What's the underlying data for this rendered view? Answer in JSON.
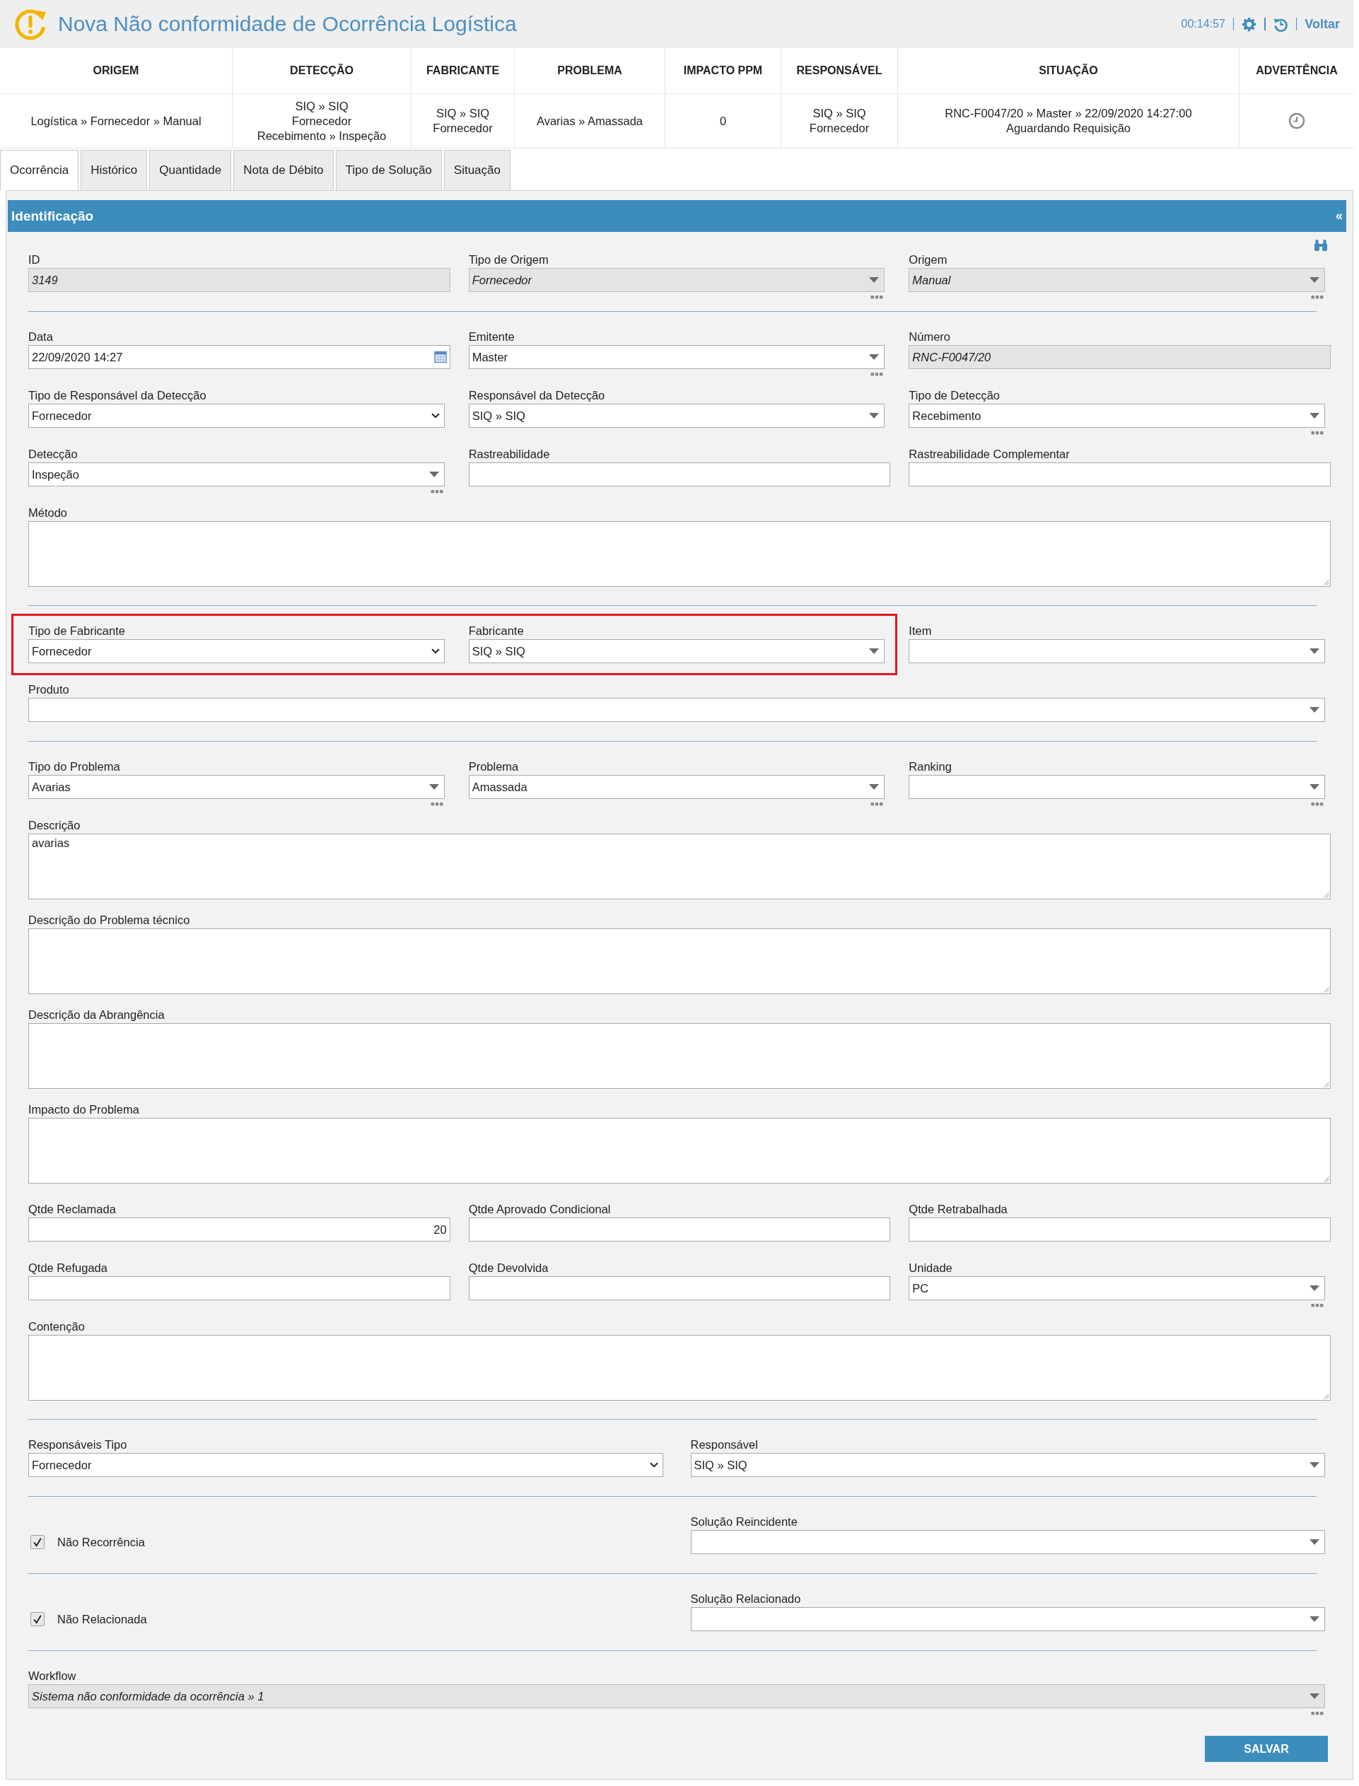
{
  "header": {
    "title": "Nova Não conformidade de Ocorrência Logística",
    "timer": "00:14:57",
    "back_link": "Voltar"
  },
  "summary": {
    "columns": [
      "ORIGEM",
      "DETECÇÃO",
      "FABRICANTE",
      "PROBLEMA",
      "IMPACTO PPM",
      "RESPONSÁVEL",
      "SITUAÇÃO",
      "ADVERTÊNCIA"
    ],
    "cells": [
      {
        "kind": "text",
        "lines": [
          "Logística » Fornecedor » Manual"
        ]
      },
      {
        "kind": "text",
        "lines": [
          "SIQ » SIQ",
          "Fornecedor",
          "Recebimento » Inspeção"
        ]
      },
      {
        "kind": "text",
        "lines": [
          "SIQ » SIQ",
          "Fornecedor"
        ]
      },
      {
        "kind": "text",
        "lines": [
          "Avarias » Amassada"
        ]
      },
      {
        "kind": "text",
        "lines": [
          "0"
        ]
      },
      {
        "kind": "text",
        "lines": [
          "SIQ » SIQ",
          "Fornecedor"
        ]
      },
      {
        "kind": "text",
        "lines": [
          "RNC-F0047/20 » Master » 22/09/2020 14:27:00",
          "Aguardando Requisição"
        ]
      },
      {
        "kind": "clock"
      }
    ]
  },
  "tabs": [
    {
      "label": "Ocorrência",
      "selected": true
    },
    {
      "label": "Histórico",
      "selected": false
    },
    {
      "label": "Quantidade",
      "selected": false
    },
    {
      "label": "Nota de Débito",
      "selected": false
    },
    {
      "label": "Tipo de Solução",
      "selected": false
    },
    {
      "label": "Situação",
      "selected": false
    }
  ],
  "panel": {
    "title": "Identificação",
    "collapse": "«",
    "submit": "SALVAR",
    "rows": [
      {
        "kind": "fields",
        "items": [
          {
            "label": "ID",
            "kind": "text",
            "value": "3149",
            "readonly": true,
            "more": false
          },
          {
            "label": "Tipo de Origem",
            "kind": "combo",
            "value": "Fornecedor",
            "readonly": true,
            "more": true
          },
          {
            "label": "Origem",
            "kind": "combo",
            "value": "Manual",
            "readonly": true,
            "more": true
          }
        ]
      },
      {
        "kind": "divider"
      },
      {
        "kind": "fields",
        "items": [
          {
            "label": "Data",
            "kind": "date",
            "value": "22/09/2020 14:27",
            "readonly": false,
            "more": false
          },
          {
            "label": "Emitente",
            "kind": "combo",
            "value": "Master",
            "readonly": false,
            "more": true
          },
          {
            "label": "Número",
            "kind": "text",
            "value": "RNC-F0047/20",
            "readonly": true,
            "more": false
          }
        ]
      },
      {
        "kind": "fields",
        "items": [
          {
            "label": "Tipo de Responsável da Detecção",
            "kind": "select",
            "value": "Fornecedor",
            "readonly": false,
            "more": false
          },
          {
            "label": "Responsável da Detecção",
            "kind": "combo",
            "value": "SIQ » SIQ",
            "readonly": false,
            "more": false
          },
          {
            "label": "Tipo de Detecção",
            "kind": "combo",
            "value": "Recebimento",
            "readonly": false,
            "more": true
          }
        ]
      },
      {
        "kind": "fields",
        "items": [
          {
            "label": "Detecção",
            "kind": "combo",
            "value": "Inspeção",
            "readonly": false,
            "more": true
          },
          {
            "label": "Rastreabilidade",
            "kind": "text",
            "readonly": false,
            "more": false
          },
          {
            "label": "Rastreabilidade Complementar",
            "kind": "text",
            "readonly": false,
            "more": false
          }
        ]
      },
      {
        "kind": "fields",
        "items": [
          {
            "label": "Método",
            "kind": "textarea",
            "readonly": false
          }
        ]
      },
      {
        "kind": "divider"
      },
      {
        "kind": "fields",
        "items": [
          {
            "kind": "group",
            "highlighted": true,
            "fields": [
              {
                "label": "Tipo de Fabricante",
                "kind": "select",
                "value": "Fornecedor",
                "readonly": false,
                "more": false
              },
              {
                "label": "Fabricante",
                "kind": "combo",
                "value": "SIQ » SIQ",
                "readonly": false,
                "more": false
              }
            ]
          },
          {
            "label": "Item",
            "kind": "combo",
            "readonly": false,
            "more": false
          }
        ]
      },
      {
        "kind": "fields",
        "items": [
          {
            "label": "Produto",
            "kind": "combo",
            "readonly": false,
            "more": false
          }
        ]
      },
      {
        "kind": "divider"
      },
      {
        "kind": "fields",
        "items": [
          {
            "label": "Tipo do Problema",
            "kind": "combo",
            "value": "Avarias",
            "readonly": false,
            "more": true
          },
          {
            "label": "Problema",
            "kind": "combo",
            "value": "Amassada",
            "readonly": false,
            "more": true
          },
          {
            "label": "Ranking",
            "kind": "combo",
            "readonly": false,
            "more": true
          }
        ]
      },
      {
        "kind": "fields",
        "items": [
          {
            "label": "Descrição",
            "kind": "textarea",
            "value": "avarias",
            "readonly": false
          }
        ]
      },
      {
        "kind": "fields",
        "items": [
          {
            "label": "Descrição do Problema técnico",
            "kind": "textarea",
            "readonly": false
          }
        ]
      },
      {
        "kind": "fields",
        "items": [
          {
            "label": "Descrição da Abrangência",
            "kind": "textarea",
            "readonly": false
          }
        ]
      },
      {
        "kind": "fields",
        "items": [
          {
            "label": "Impacto do Problema",
            "kind": "textarea",
            "readonly": false
          }
        ]
      },
      {
        "kind": "fields",
        "items": [
          {
            "label": "Qtde Reclamada",
            "kind": "number",
            "value": "20",
            "readonly": false,
            "more": false
          },
          {
            "label": "Qtde Aprovado Condicional",
            "kind": "text",
            "readonly": false,
            "more": false
          },
          {
            "label": "Qtde Retrabalhada",
            "kind": "text",
            "readonly": false,
            "more": false
          }
        ]
      },
      {
        "kind": "fields",
        "items": [
          {
            "label": "Qtde Refugada",
            "kind": "text",
            "readonly": false,
            "more": false
          },
          {
            "label": "Qtde Devolvida",
            "kind": "text",
            "readonly": false,
            "more": false
          },
          {
            "label": "Unidade",
            "kind": "combo",
            "value": "PC",
            "readonly": false,
            "more": true
          }
        ]
      },
      {
        "kind": "fields",
        "items": [
          {
            "label": "Contenção",
            "kind": "textarea",
            "readonly": false
          }
        ]
      },
      {
        "kind": "divider"
      },
      {
        "kind": "fields",
        "items": [
          {
            "label": "Responsáveis Tipo",
            "kind": "select",
            "value": "Fornecedor",
            "readonly": false,
            "more": false
          },
          {
            "label": "Responsável",
            "kind": "combo",
            "value": "SIQ » SIQ",
            "readonly": false,
            "more": false
          }
        ]
      },
      {
        "kind": "divider"
      },
      {
        "kind": "check",
        "checkbox": {
          "label": "Não Recorrência",
          "checked": true
        },
        "field": {
          "label": "Solução Reincidente",
          "kind": "combo",
          "readonly": false,
          "more": false
        }
      },
      {
        "kind": "divider"
      },
      {
        "kind": "check",
        "checkbox": {
          "label": "Não Relacionada",
          "checked": true
        },
        "field": {
          "label": "Solução Relacionado",
          "kind": "combo",
          "readonly": false,
          "more": false
        }
      },
      {
        "kind": "divider"
      },
      {
        "kind": "fields",
        "items": [
          {
            "label": "Workflow",
            "kind": "combo",
            "value": "Sistema não conformidade da ocorrência » 1",
            "readonly": true,
            "more": true
          }
        ]
      }
    ]
  }
}
